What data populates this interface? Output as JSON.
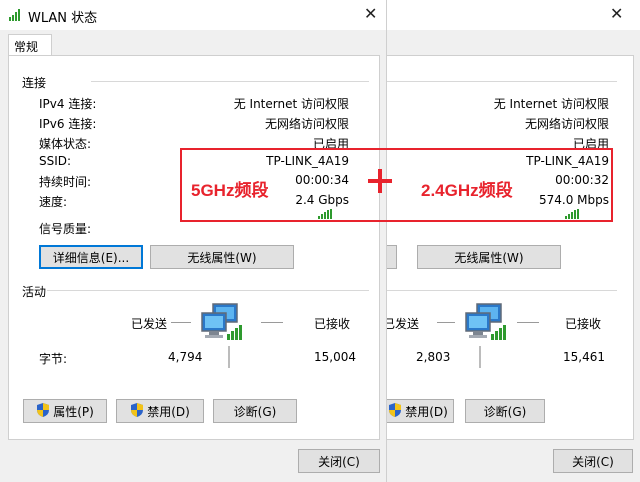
{
  "left_window": {
    "title": "WLAN 状态",
    "close_glyph": "✕",
    "tab_label": "常规",
    "connection_section": "连接",
    "rows": [
      {
        "label": "IPv4 连接:",
        "value": "无 Internet 访问权限"
      },
      {
        "label": "IPv6 连接:",
        "value": "无网络访问权限"
      },
      {
        "label": "媒体状态:",
        "value": "已启用"
      },
      {
        "label": "SSID:",
        "value": "TP-LINK_4A19"
      },
      {
        "label": "持续时间:",
        "value": "00:00:34"
      },
      {
        "label": "速度:",
        "value": "2.4 Gbps"
      }
    ],
    "signal_label": "信号质量:",
    "details_button": "详细信息(E)...",
    "wireless_props_button": "无线属性(W)",
    "activity_section": "活动",
    "sent_label": "已发送",
    "received_label": "已接收",
    "bytes_label": "字节:",
    "bytes_sent": "4,794",
    "bytes_received": "15,004",
    "properties_button": "属性(P)",
    "disable_button": "禁用(D)",
    "diagnose_button": "诊断(G)",
    "close_button": "关闭(C)"
  },
  "right_window": {
    "close_glyph": "✕",
    "rows": [
      {
        "value": "无 Internet 访问权限"
      },
      {
        "value": "无网络访问权限"
      },
      {
        "value": "已启用"
      },
      {
        "value": "TP-LINK_4A19"
      },
      {
        "value": "00:00:32"
      },
      {
        "value": "574.0 Mbps"
      }
    ],
    "wireless_props_button": "无线属性(W)",
    "sent_label": "已发送",
    "received_label": "已接收",
    "bytes_sent": "2,803",
    "bytes_received": "15,461",
    "disable_button": "禁用(D)",
    "diagnose_button": "诊断(G)",
    "close_button": "关闭(C)"
  },
  "annotation": {
    "left_text": "5GHz频段",
    "right_text": "2.4GHz频段",
    "color": "#e8232d"
  },
  "icons": {
    "app": "wlan-status-icon",
    "network": "network-computers-icon",
    "shield": "uac-shield-icon",
    "signal": "signal-bars-icon"
  }
}
